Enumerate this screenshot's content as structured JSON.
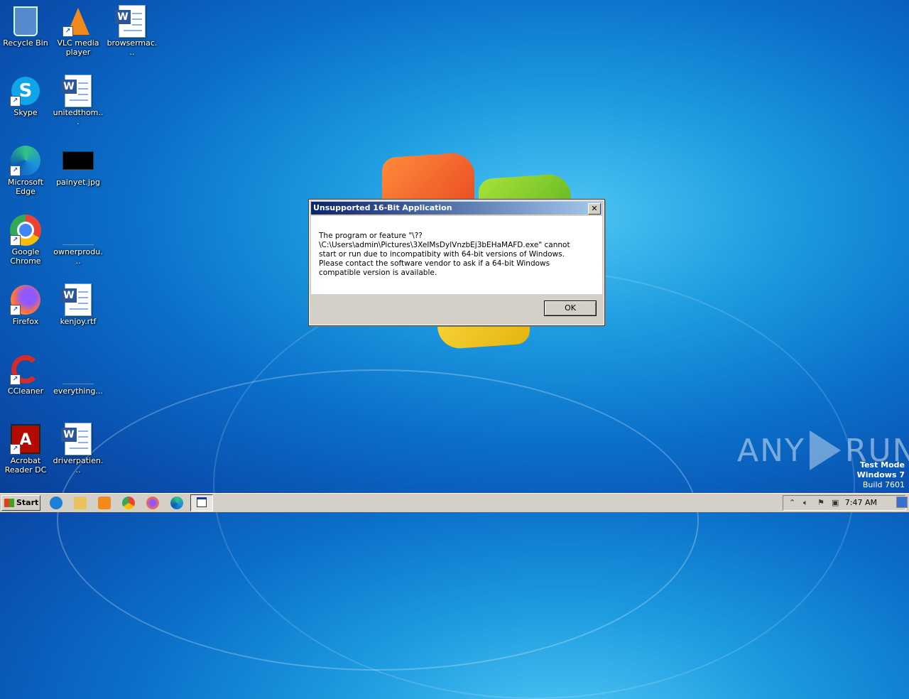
{
  "desktop": {
    "icons": [
      {
        "label": "Recycle Bin"
      },
      {
        "label": "VLC media player"
      },
      {
        "label": "browsermac..."
      },
      {
        "label": "Skype"
      },
      {
        "label": "unitedthom..."
      },
      {
        "label": "Microsoft Edge"
      },
      {
        "label": "painyet.jpg"
      },
      {
        "label": "Google Chrome"
      },
      {
        "label": "ownerprodu..."
      },
      {
        "label": "Firefox"
      },
      {
        "label": "kenjoy.rtf"
      },
      {
        "label": "CCleaner"
      },
      {
        "label": "everything..."
      },
      {
        "label": "Acrobat Reader DC"
      },
      {
        "label": "driverpatien..."
      }
    ]
  },
  "dialog": {
    "title": "Unsupported 16-Bit Application",
    "close_glyph": "✕",
    "message": "The program or feature \"\\??\\C:\\Users\\admin\\Pictures\\3XeIMsDylVnzbEj3bEHaMAFD.exe\" cannot start or run due to incompatibity with 64-bit versions of Windows. Please contact the software vendor to ask if a 64-bit Windows compatible version is available.",
    "ok_label": "OK"
  },
  "watermark": {
    "left": "ANY",
    "right": "RUN"
  },
  "system": {
    "test_mode": "Test Mode",
    "os": "Windows 7",
    "build": "Build 7601"
  },
  "taskbar": {
    "start_label": "Start",
    "clock": "7:47 AM"
  },
  "colors": {
    "title_start": "#0a246a",
    "title_end": "#a6caf0",
    "taskbar": "#d4d0c8"
  }
}
